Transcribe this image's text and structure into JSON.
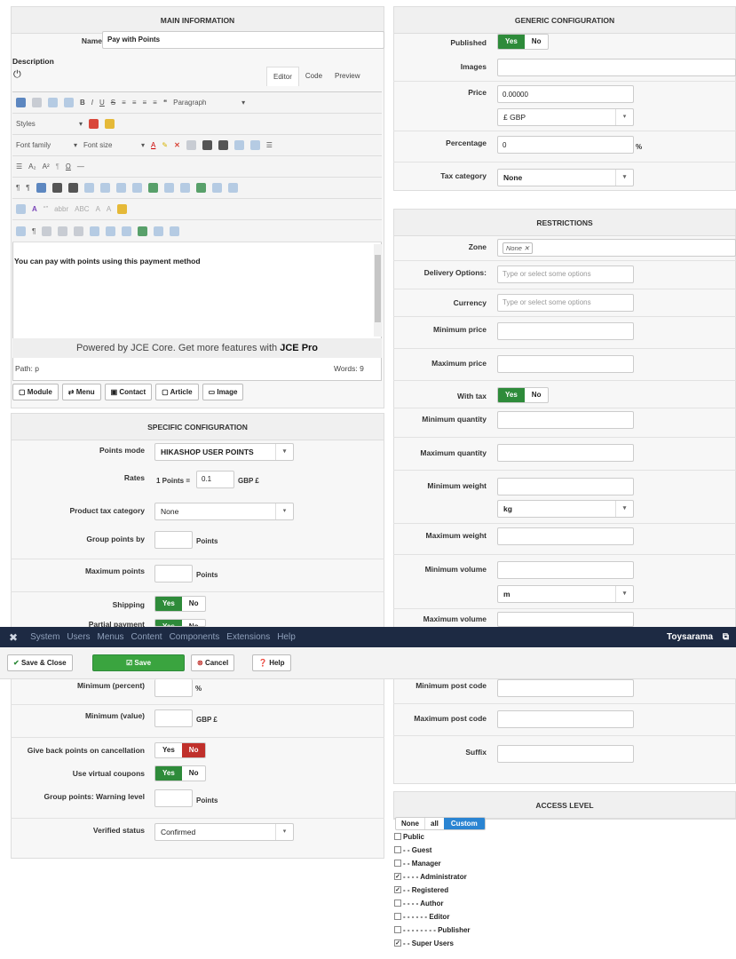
{
  "main_info": {
    "title": "MAIN INFORMATION",
    "name_label": "Name",
    "name_value": "Pay with Points",
    "description_label": "Description",
    "tabs": [
      "Editor",
      "Code",
      "Preview"
    ],
    "paragraph_select": "Paragraph",
    "styles_select": "Styles",
    "font_family": "Font family",
    "font_size": "Font size",
    "content": "You can pay with points using this payment method",
    "powered_by": "Powered by JCE Core. Get more features with ",
    "powered_pro": "JCE Pro",
    "path": "Path: p",
    "words": "Words: 9",
    "buttons": [
      "Module",
      "Menu",
      "Contact",
      "Article",
      "Image"
    ]
  },
  "specific": {
    "title": "SPECIFIC CONFIGURATION",
    "points_mode_label": "Points mode",
    "points_mode_value": "HIKASHOP USER POINTS",
    "rates_label": "Rates",
    "rates_prefix": "1 Points =",
    "rates_value": "0.1",
    "rates_unit": "GBP £",
    "product_tax_label": "Product tax category",
    "product_tax_value": "None",
    "group_points_label": "Group points by",
    "group_points_unit": "Points",
    "max_points_label": "Maximum points",
    "max_points_unit": "Points",
    "shipping_label": "Shipping",
    "partial_label": "Partial payment",
    "min_percent_label": "Minimum (percent)",
    "min_percent_unit": "%",
    "min_value_label": "Minimum (value)",
    "min_value_unit": "GBP £",
    "give_back_label": "Give back points on cancellation",
    "virtual_label": "Use virtual coupons",
    "warning_label": "Group points: Warning level",
    "warning_unit": "Points",
    "verified_label": "Verified status",
    "verified_value": "Confirmed",
    "yes": "Yes",
    "no": "No"
  },
  "generic": {
    "title": "GENERIC CONFIGURATION",
    "published_label": "Published",
    "images_label": "Images",
    "price_label": "Price",
    "price_value": "0.00000",
    "currency_value": "£ GBP",
    "percentage_label": "Percentage",
    "percentage_value": "0",
    "percentage_unit": "%",
    "tax_label": "Tax category",
    "tax_value": "None"
  },
  "restrictions": {
    "title": "RESTRICTIONS",
    "zone_label": "Zone",
    "zone_tag": "None",
    "delivery_label": "Delivery Options:",
    "delivery_placeholder": "Type or select some options",
    "currency_label": "Currency",
    "currency_placeholder": "Type or select some options",
    "min_price_label": "Minimum price",
    "max_price_label": "Maximum price",
    "with_tax_label": "With tax",
    "min_qty_label": "Minimum quantity",
    "max_qty_label": "Maximum quantity",
    "min_weight_label": "Minimum weight",
    "weight_unit": "kg",
    "max_weight_label": "Maximum weight",
    "min_volume_label": "Minimum volume",
    "volume_unit": "m",
    "max_volume_label": "Maximum volume",
    "min_post_label": "Minimum post code",
    "max_post_label": "Maximum post code",
    "suffix_label": "Suffix"
  },
  "access": {
    "title": "ACCESS LEVEL",
    "modes": [
      "None",
      "all",
      "Custom"
    ],
    "groups": [
      {
        "label": "Public",
        "checked": false
      },
      {
        "label": "- - Guest",
        "checked": false
      },
      {
        "label": "- - Manager",
        "checked": false
      },
      {
        "label": "- - - - Administrator",
        "checked": true
      },
      {
        "label": "- - Registered",
        "checked": true
      },
      {
        "label": "- - - - Author",
        "checked": false
      },
      {
        "label": "- - - - - - Editor",
        "checked": false
      },
      {
        "label": "- - - - - - - - Publisher",
        "checked": false
      },
      {
        "label": "- - Super Users",
        "checked": true
      }
    ]
  },
  "admin": {
    "menu": [
      "System",
      "Users",
      "Menus",
      "Content",
      "Components",
      "Extensions",
      "Help"
    ],
    "site_name": "Toysarama",
    "save_close": "Save & Close",
    "save": "Save",
    "cancel": "Cancel",
    "help": "Help"
  }
}
